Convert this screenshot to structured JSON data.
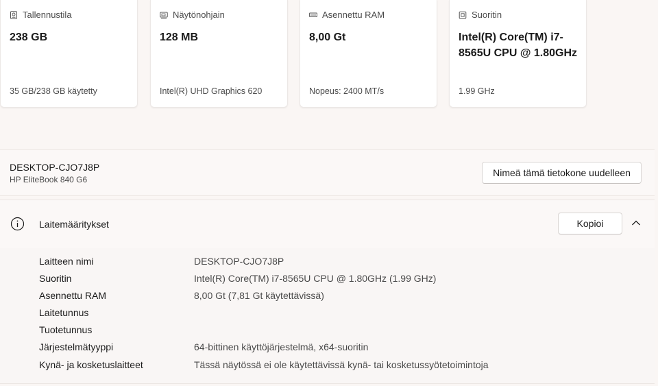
{
  "cards": [
    {
      "title": "Tallennustila",
      "value": "238 GB",
      "sub": "35 GB/238 GB käytetty",
      "icon": "storage-icon"
    },
    {
      "title": "Näytönohjain",
      "value": "128 MB",
      "sub": "Intel(R) UHD Graphics 620",
      "icon": "gpu-icon"
    },
    {
      "title": "Asennettu RAM",
      "value": "8,00 Gt",
      "sub": "Nopeus: 2400 MT/s",
      "icon": "ram-icon"
    },
    {
      "title": "Suoritin",
      "value": "Intel(R) Core(TM) i7-8565U CPU @ 1.80GHz",
      "sub": "1.99 GHz",
      "icon": "cpu-icon"
    }
  ],
  "device": {
    "name": "DESKTOP-CJO7J8P",
    "model": "HP EliteBook 840 G6",
    "rename_label": "Nimeä tämä tietokone uudelleen"
  },
  "specs": {
    "title": "Laitemääritykset",
    "copy_label": "Kopioi",
    "expanded": true,
    "rows": [
      {
        "key": "Laitteen nimi",
        "value": "DESKTOP-CJO7J8P"
      },
      {
        "key": "Suoritin",
        "value": "Intel(R) Core(TM) i7-8565U CPU @ 1.80GHz (1.99 GHz)"
      },
      {
        "key": "Asennettu RAM",
        "value": "8,00 Gt (7,81 Gt käytettävissä)"
      },
      {
        "key": "Laitetunnus",
        "value": ""
      },
      {
        "key": "Tuotetunnus",
        "value": ""
      },
      {
        "key": "Järjestelmätyyppi",
        "value": "64-bittinen käyttöjärjestelmä, x64-suoritin"
      },
      {
        "key": "Kynä- ja kosketuslaitteet",
        "value": "Tässä näytössä ei ole käytettävissä kynä- tai kosketussyötetoimintoja"
      }
    ]
  }
}
